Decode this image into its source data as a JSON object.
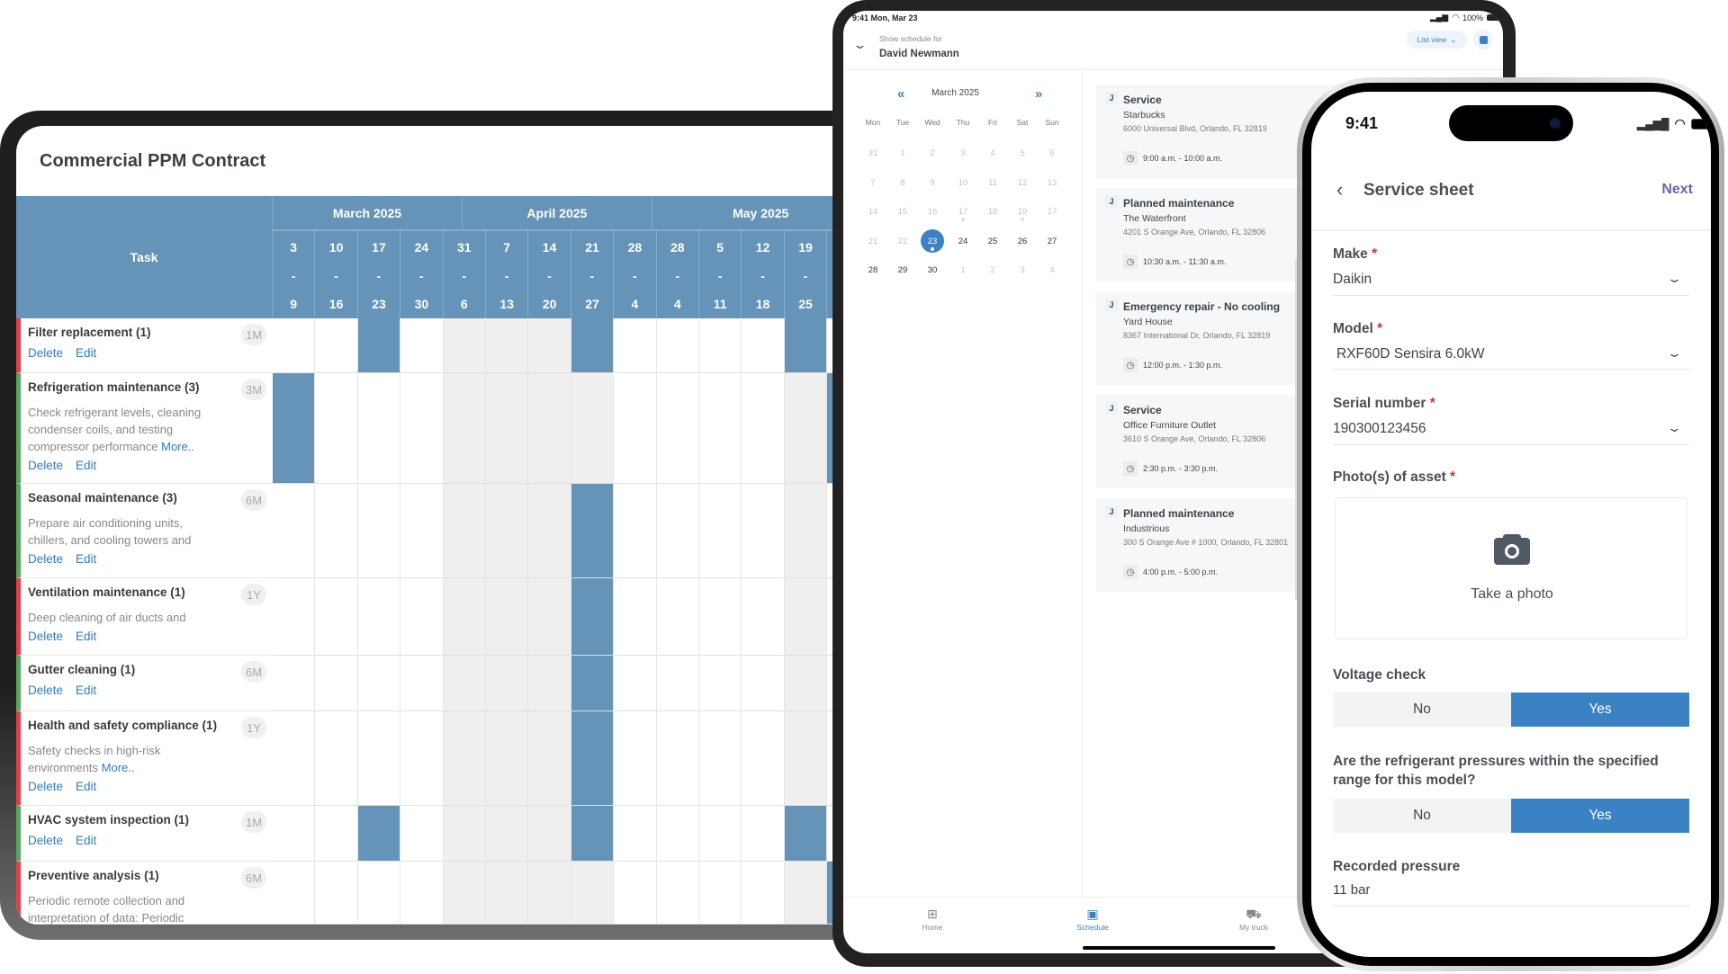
{
  "contract": {
    "title": "Commercial PPM Contract",
    "task_header": "Task",
    "months": [
      "March 2025",
      "April 2025",
      "May 2025"
    ],
    "weeks": [
      [
        "3",
        "9"
      ],
      [
        "10",
        "16"
      ],
      [
        "17",
        "23"
      ],
      [
        "24",
        "30"
      ],
      [
        "31",
        "6"
      ],
      [
        "7",
        "13"
      ],
      [
        "14",
        "20"
      ],
      [
        "21",
        "27"
      ],
      [
        "28",
        "4"
      ],
      [
        "28",
        "4"
      ],
      [
        "5",
        "11"
      ],
      [
        "12",
        "18"
      ],
      [
        "19",
        "25"
      ],
      [
        "",
        ""
      ]
    ],
    "week_separator": "-",
    "shaded_weeks": [
      4,
      5,
      6,
      7,
      12
    ],
    "bar_color": "#6594b8",
    "delete_label": "Delete",
    "edit_label": "Edit",
    "more_label": "More..",
    "tasks": [
      {
        "title": "Filter replacement (1)",
        "freq": "1M",
        "desc": "",
        "more": false,
        "status_color": "#e0404a",
        "weeks": [
          2,
          7,
          12
        ]
      },
      {
        "title": "Refrigeration maintenance (3)",
        "freq": "3M",
        "desc": "Check refrigerant levels, cleaning condenser coils, and testing compressor performance",
        "more": true,
        "status_color": "#5aa55e",
        "weeks": [
          0,
          13
        ]
      },
      {
        "title": "Seasonal maintenance (3)",
        "freq": "6M",
        "desc": "Prepare air conditioning units, chillers, and cooling towers and",
        "more": false,
        "status_color": "#5aa55e",
        "weeks": [
          7
        ]
      },
      {
        "title": "Ventilation maintenance (1)",
        "freq": "1Y",
        "desc": "Deep cleaning of air ducts and",
        "more": false,
        "status_color": "#e0404a",
        "weeks": [
          7
        ]
      },
      {
        "title": "Gutter cleaning (1)",
        "freq": "6M",
        "desc": "",
        "more": false,
        "status_color": "#5aa55e",
        "weeks": [
          7
        ]
      },
      {
        "title": "Health and safety compliance (1)",
        "freq": "1Y",
        "desc": "Safety checks in high-risk environments",
        "more": true,
        "status_color": "#e0404a",
        "weeks": [
          7
        ]
      },
      {
        "title": "HVAC system inspection (1)",
        "freq": "1M",
        "desc": "",
        "more": false,
        "status_color": "#5aa55e",
        "weeks": [
          2,
          7,
          12
        ]
      },
      {
        "title": "Preventive analysis (1)",
        "freq": "6M",
        "desc": "Periodic remote collection and interpretation of data: Periodic",
        "more": false,
        "status_color": "#e0404a",
        "weeks": [
          13
        ]
      }
    ]
  },
  "schedule": {
    "status_time": "9:41  Mon, Mar 23",
    "battery": "100%",
    "show_for_label": "Show schedule for",
    "person": "David Newmann",
    "view_toggle": "List view",
    "calendar": {
      "month": "March 2025",
      "weekdays": [
        "Mon",
        "Tue",
        "Wed",
        "Thu",
        "Fri",
        "Sat",
        "Sun"
      ],
      "days": [
        [
          {
            "d": "31",
            "m": true
          },
          {
            "d": "1",
            "m": true
          },
          {
            "d": "2",
            "m": true
          },
          {
            "d": "3",
            "m": true
          },
          {
            "d": "4",
            "m": true
          },
          {
            "d": "5",
            "m": true
          },
          {
            "d": "6",
            "m": true
          }
        ],
        [
          {
            "d": "7",
            "m": true
          },
          {
            "d": "8",
            "m": true
          },
          {
            "d": "9",
            "m": true
          },
          {
            "d": "10",
            "m": true
          },
          {
            "d": "11",
            "m": true
          },
          {
            "d": "12",
            "m": true
          },
          {
            "d": "13",
            "m": true
          }
        ],
        [
          {
            "d": "14",
            "m": true
          },
          {
            "d": "15",
            "m": true
          },
          {
            "d": "16",
            "m": true
          },
          {
            "d": "17",
            "m": true,
            "dot": true
          },
          {
            "d": "18",
            "m": true
          },
          {
            "d": "19",
            "m": true,
            "dot": true
          },
          {
            "d": "17",
            "m": true
          }
        ],
        [
          {
            "d": "21",
            "m": true
          },
          {
            "d": "22",
            "m": true
          },
          {
            "d": "23",
            "sel": true,
            "dot": true
          },
          {
            "d": "24"
          },
          {
            "d": "25"
          },
          {
            "d": "26"
          },
          {
            "d": "27"
          }
        ],
        [
          {
            "d": "28"
          },
          {
            "d": "29"
          },
          {
            "d": "30"
          },
          {
            "d": "1",
            "m": true
          },
          {
            "d": "2",
            "m": true
          },
          {
            "d": "3",
            "m": true
          },
          {
            "d": "4",
            "m": true
          }
        ]
      ]
    },
    "jobs": [
      {
        "badge": "J",
        "title": "Service",
        "location": "Starbucks",
        "address": "6000 Universal Blvd, Orlando, FL 32819",
        "time": "9:00 a.m. - 10:00 a.m."
      },
      {
        "badge": "J",
        "title": "Planned maintenance",
        "location": "The Waterfront",
        "address": "4201 S Orange Ave, Orlando, FL 32806",
        "time": "10:30 a.m. - 11:30 a.m."
      },
      {
        "badge": "J",
        "title": "Emergency repair - No cooling",
        "location": "Yard House",
        "address": "8367 International Dr, Orlando, FL 32819",
        "time": "12:00 p.m. - 1:30 p.m."
      },
      {
        "badge": "J",
        "title": "Service",
        "location": "Office Furniture Outlet",
        "address": "3610 S Orange Ave, Orlando, FL 32806",
        "time": "2:30 p.m. - 3:30 p.m."
      },
      {
        "badge": "J",
        "title": "Planned maintenance",
        "location": "Industrious",
        "address": "300 S Orange Ave # 1000, Orlando, FL 32801",
        "time": "4:00 p.m. - 5:00 p.m."
      }
    ],
    "nav": [
      {
        "label": "Home",
        "icon": "grid-icon",
        "active": false
      },
      {
        "label": "Schedule",
        "icon": "calendar-icon",
        "active": true
      },
      {
        "label": "My truck",
        "icon": "truck-icon",
        "active": false
      }
    ],
    "accent": "#3a82c4"
  },
  "service_sheet": {
    "time": "9:41",
    "title": "Service sheet",
    "next_label": "Next",
    "next_color": "#7461b0",
    "required_mark": "*",
    "make": {
      "label": "Make",
      "value": "Daikin"
    },
    "model": {
      "label": "Model",
      "value": "RXF60D Sensira 6.0kW"
    },
    "serial": {
      "label": "Serial number",
      "value": "190300123456"
    },
    "photo": {
      "label": "Photo(s) of asset",
      "action": "Take a photo"
    },
    "voltage": {
      "label": "Voltage check",
      "options": [
        "No",
        "Yes"
      ],
      "selected": "Yes"
    },
    "pressure_q": {
      "label": "Are the refrigerant pressures within the specified range for this model?",
      "options": [
        "No",
        "Yes"
      ],
      "selected": "Yes"
    },
    "recorded": {
      "label": "Recorded pressure",
      "value": "11 bar"
    }
  }
}
